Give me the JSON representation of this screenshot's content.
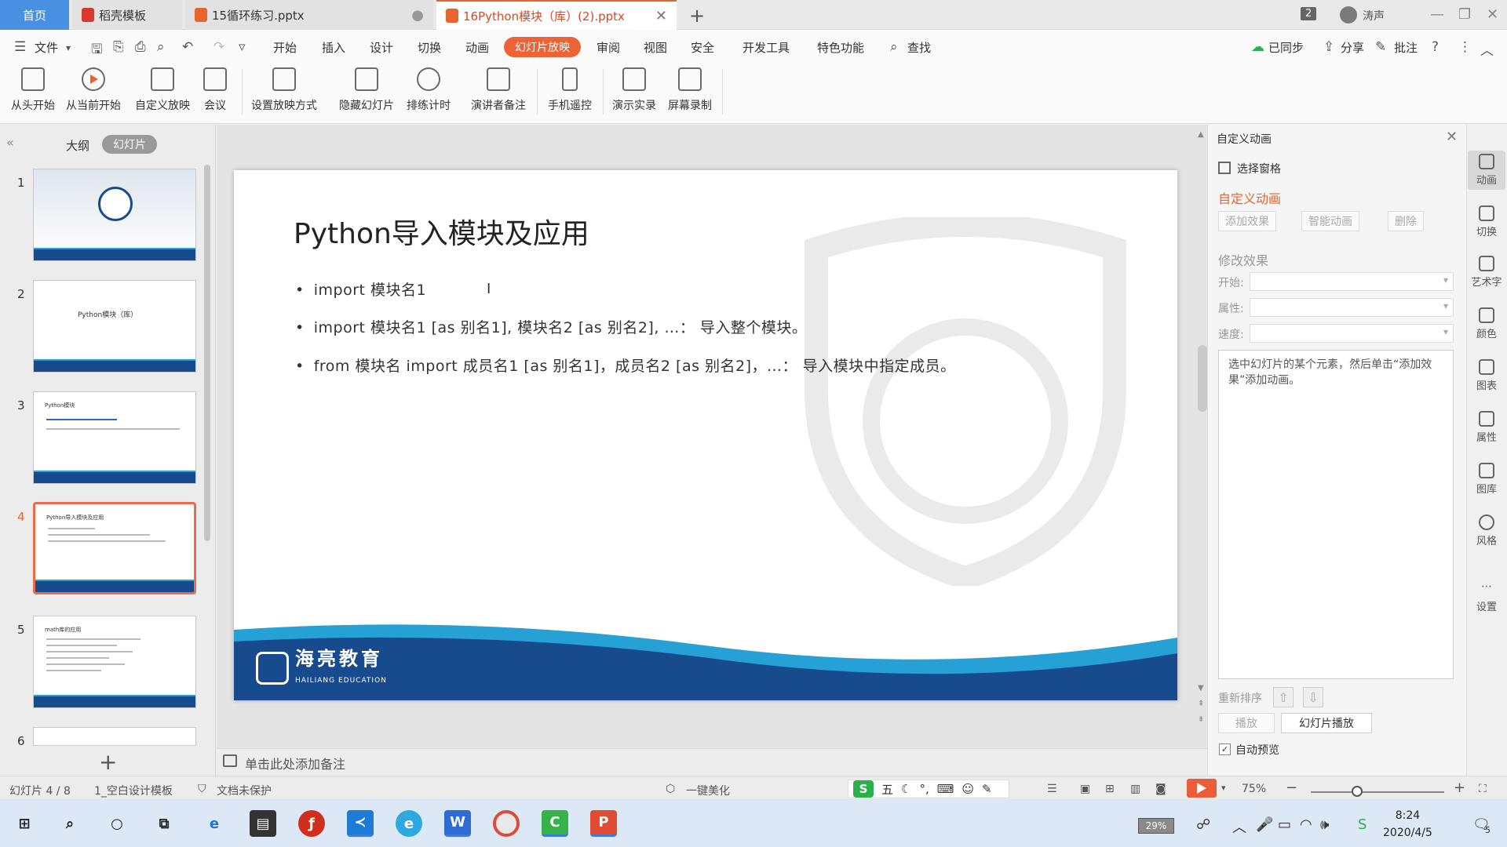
{
  "tabs": {
    "home": "首页",
    "templates": "稻壳模板",
    "file1": "15循环练习.pptx",
    "file2": "16Python模块（库）(2).pptx"
  },
  "window": {
    "count": "2",
    "user": "涛声"
  },
  "menu": {
    "file": "文件",
    "items": [
      "开始",
      "插入",
      "设计",
      "切换",
      "动画",
      "幻灯片放映",
      "审阅",
      "视图",
      "安全",
      "开发工具",
      "特色功能"
    ],
    "active": "幻灯片放映",
    "search": "查找",
    "sync": "已同步",
    "share": "分享",
    "comment": "批注"
  },
  "ribbon": {
    "buttons": [
      "从头开始",
      "从当前开始",
      "自定义放映",
      "会议",
      "设置放映方式",
      "隐藏幻灯片",
      "排练计时",
      "演讲者备注",
      "手机遥控",
      "演示实录",
      "屏幕录制"
    ]
  },
  "leftpanel": {
    "tab_outline": "大纲",
    "tab_slides": "幻灯片",
    "thumbs": [
      {
        "num": "1",
        "title": ""
      },
      {
        "num": "2",
        "title": "Python模块（库）"
      },
      {
        "num": "3",
        "title": "Python模块"
      },
      {
        "num": "4",
        "title": "Python导入模块及应用"
      },
      {
        "num": "5",
        "title": "math库的应用"
      },
      {
        "num": "6",
        "title": ""
      }
    ]
  },
  "slide": {
    "title": "Python导入模块及应用",
    "bullets": [
      "import 模块名1",
      "import 模块名1 [as 别名1], 模块名2 [as 别名2], …：  导入整个模块。",
      "from 模块名 import 成员名1 [as 别名1]，成员名2 [as 别名2]，…：  导入模块中指定成员。"
    ],
    "logo_cn": "海亮教育",
    "logo_en": "HAILIANG EDUCATION"
  },
  "notes": {
    "placeholder": "单击此处添加备注"
  },
  "rightpane": {
    "title": "自定义动画",
    "select_pane": "选择窗格",
    "subtitle": "自定义动画",
    "add_effect": "添加效果",
    "smart_anim": "智能动画",
    "delete": "删除",
    "modify": "修改效果",
    "start": "开始:",
    "property": "属性:",
    "speed": "速度:",
    "hint": "选中幻灯片的某个元素，然后单击“添加效果”添加动画。",
    "reorder": "重新排序",
    "play": "播放",
    "slide_play": "幻灯片播放",
    "auto_preview": "自动预览"
  },
  "rail": [
    "动画",
    "切换",
    "艺术字",
    "颜色",
    "图表",
    "属性",
    "图库",
    "风格",
    "设置"
  ],
  "status": {
    "slide_pos": "幻灯片 4 / 8",
    "template": "1_空白设计模板",
    "protect": "文档未保护",
    "beautify": "一键美化",
    "zoom": "75%",
    "ime_mode": "五"
  },
  "taskbar": {
    "battery": "29%",
    "time": "8:24",
    "date": "2020/4/5",
    "notif": "5"
  },
  "colors": {
    "accent": "#e8642e",
    "brand_blue": "#184b8e",
    "wave_light": "#25a1d6"
  }
}
